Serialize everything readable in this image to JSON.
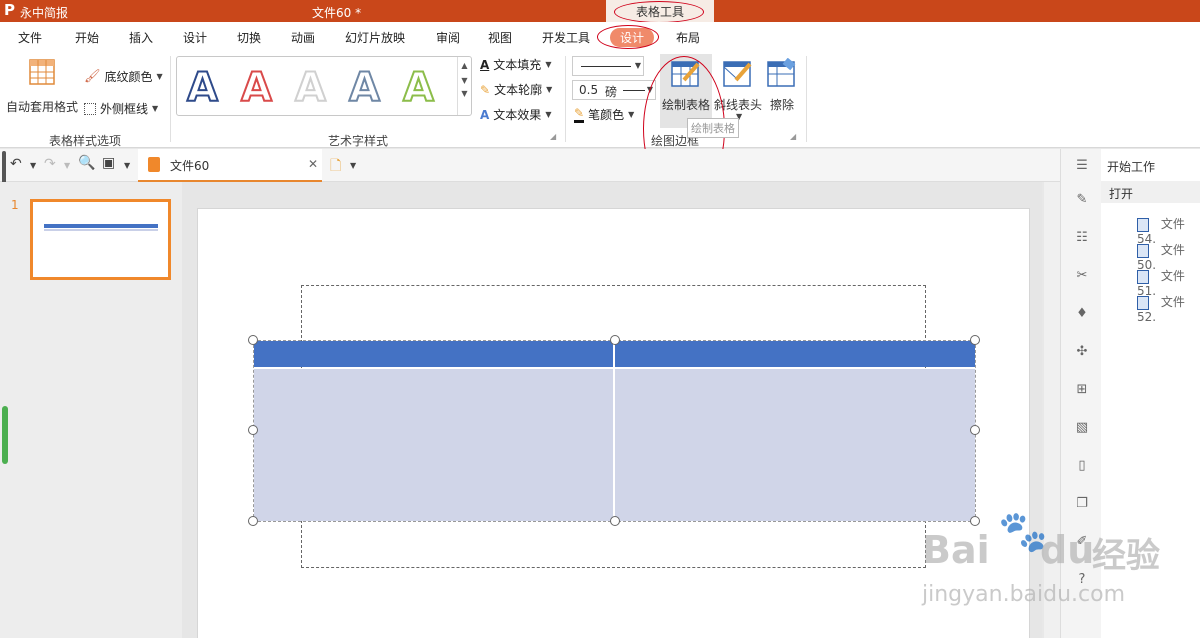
{
  "titlebar": {
    "app_name": "永中简报",
    "doc_title": "文件60 *",
    "context_tab": "表格工具"
  },
  "menu": {
    "items": [
      "文件",
      "开始",
      "插入",
      "设计",
      "切换",
      "动画",
      "幻灯片放映",
      "审阅",
      "视图",
      "开发工具",
      "设计",
      "布局"
    ],
    "active_index": 10
  },
  "ribbon": {
    "table_style_group": {
      "auto_format": "自动套用格式",
      "shading": "底纹颜色",
      "border": "外侧框线",
      "label": "表格样式选项"
    },
    "wordart_group": {
      "label": "艺术字样式",
      "text_fill": "文本填充",
      "text_outline": "文本轮廓",
      "text_effect": "文本效果",
      "samples": [
        "A",
        "A",
        "A",
        "A",
        "A"
      ],
      "sample_colors": [
        "#2e4a8a",
        "#d94a4a",
        "#c8c8c8",
        "#6f87a5",
        "#8cbd4a"
      ]
    },
    "draw_border_group": {
      "label": "绘图边框",
      "line_weight": "0.5",
      "line_unit": "磅",
      "pen_color": "笔颜色",
      "draw_table": "绘制表格",
      "diagonal_header": "斜线表头",
      "erase": "擦除",
      "tooltip": "绘制表格"
    }
  },
  "quickbar": {
    "doc_tab": "文件60"
  },
  "thumbnails": {
    "slide_number": "1"
  },
  "right_panel": {
    "section_title": "开始工作",
    "open_label": "打开",
    "recent_files": [
      "文件54.",
      "文件50.",
      "文件51.",
      "文件52."
    ]
  },
  "table": {
    "header_color": "#4472c4",
    "body_color": "#d0d5e8"
  },
  "colors": {
    "title_bar": "#c9471a",
    "accent": "#f0882b"
  },
  "watermark": {
    "text1": "Bai",
    "text2": "du",
    "text3": "经验",
    "text4": "jingyan.baidu.com"
  }
}
